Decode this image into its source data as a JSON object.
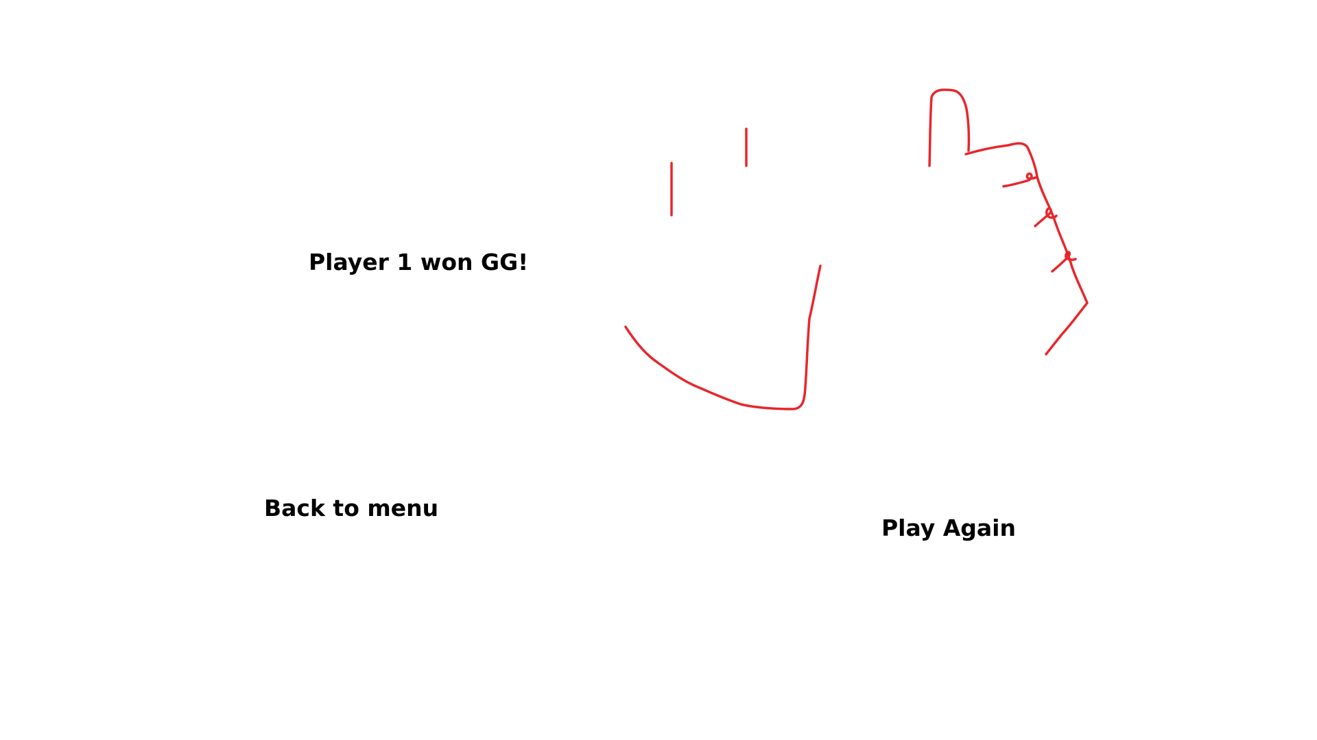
{
  "end_screen": {
    "result_text": "Player 1 won GG!",
    "back_to_menu_label": "Back to menu",
    "play_again_label": "Play Again"
  },
  "colors": {
    "background": "#ffffff",
    "text": "#000000",
    "drawing_stroke": "#e8262b"
  },
  "illustration": {
    "icon": "thumbs-up-icon"
  }
}
